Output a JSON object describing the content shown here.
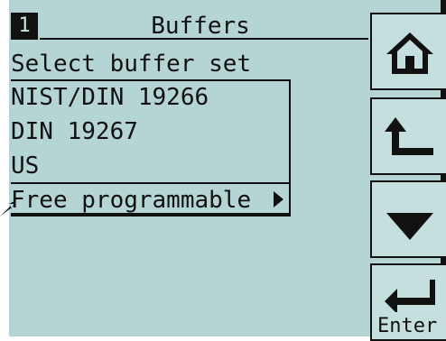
{
  "header": {
    "channel": "1",
    "title": "Buffers"
  },
  "subtitle": "Select buffer set",
  "buffer_sets": [
    {
      "label": "NIST/DIN 19266",
      "selected": false
    },
    {
      "label": "DIN 19267",
      "selected": false
    },
    {
      "label": "US",
      "selected": false
    },
    {
      "label": "Free programmable",
      "selected": true
    }
  ],
  "softkeys": {
    "enter_label": "Enter"
  }
}
